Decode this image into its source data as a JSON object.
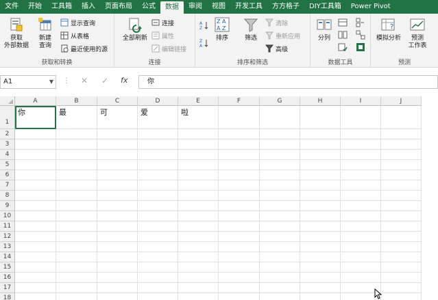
{
  "tabs": [
    "文件",
    "开始",
    "工具箱",
    "插入",
    "页面布局",
    "公式",
    "数据",
    "审阅",
    "视图",
    "开发工具",
    "方方格子",
    "DIY工具箱",
    "Power Pivot"
  ],
  "active_tab": "数据",
  "ribbon": {
    "get_transform": {
      "label": "获取和转换",
      "get_external_line1": "获取",
      "get_external_line2": "外部数据",
      "new_query_line1": "新建",
      "new_query_line2": "查询",
      "show_queries": "显示查询",
      "from_table": "从表格",
      "recent_sources": "最近使用的源"
    },
    "connections": {
      "label": "连接",
      "refresh_all": "全部刷新",
      "connections": "连接",
      "properties": "属性",
      "edit_links": "编辑链接"
    },
    "sort_filter": {
      "label": "排序和筛选",
      "sort": "排序",
      "filter": "筛选",
      "clear": "清除",
      "reapply": "重新应用",
      "advanced": "高级"
    },
    "data_tools": {
      "label": "数据工具",
      "split": "分列"
    },
    "forecast": {
      "label": "预测",
      "what_if": "模拟分析",
      "forecast_sheet_line1": "预测",
      "forecast_sheet_line2": "工作表"
    }
  },
  "formula_bar": {
    "name_box": "A1",
    "cancel": "✕",
    "enter": "✓",
    "fx": "fx",
    "content": "你"
  },
  "grid": {
    "columns": [
      "A",
      "B",
      "C",
      "D",
      "E",
      "F",
      "G",
      "H",
      "I",
      "J"
    ],
    "rows": [
      "1",
      "2",
      "3",
      "4",
      "5",
      "6",
      "7",
      "8",
      "9",
      "10",
      "11",
      "12",
      "13",
      "14",
      "15",
      "16",
      "17",
      "18"
    ],
    "row1_values": [
      "你",
      "最",
      "可",
      "爱",
      "啦",
      "",
      "",
      "",
      "",
      ""
    ]
  }
}
